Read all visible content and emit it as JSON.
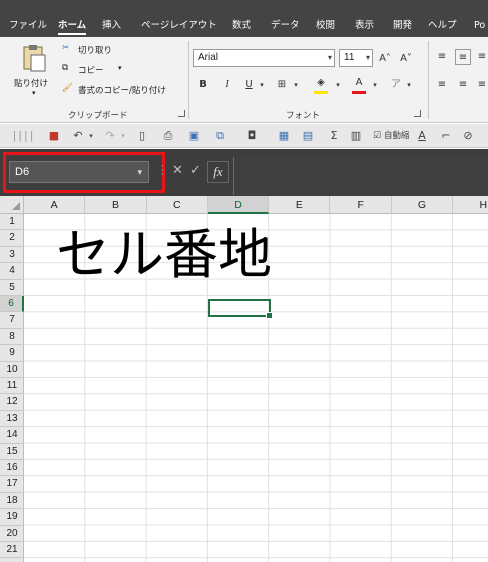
{
  "tabs": [
    {
      "label": "ファイル",
      "active": false
    },
    {
      "label": "ホーム",
      "active": true
    },
    {
      "label": "挿入",
      "active": false
    },
    {
      "label": "ページレイアウト",
      "active": false
    },
    {
      "label": "数式",
      "active": false
    },
    {
      "label": "データ",
      "active": false
    },
    {
      "label": "校閲",
      "active": false
    },
    {
      "label": "表示",
      "active": false
    },
    {
      "label": "開発",
      "active": false
    },
    {
      "label": "ヘルプ",
      "active": false
    },
    {
      "label": "Po",
      "active": false
    }
  ],
  "clipboard": {
    "paste_label": "貼り付け",
    "cut_label": "切り取り",
    "copy_label": "コピー",
    "format_painter_label": "書式のコピー/貼り付け",
    "group_label": "クリップボード"
  },
  "font": {
    "font_name": "Arial",
    "font_size": "11",
    "bold": "B",
    "italic": "I",
    "underline": "U",
    "grow": "A˄",
    "shrink": "A˅",
    "font_color_glyph": "A",
    "group_label": "フォント"
  },
  "qat": {
    "wrap_label": "自動縮"
  },
  "formula_bar": {
    "name_box": "D6",
    "fx": "fx",
    "cancel": "✕",
    "enter": "✓",
    "value": ""
  },
  "grid": {
    "columns": [
      "A",
      "B",
      "C",
      "D",
      "E",
      "F",
      "G",
      "H"
    ],
    "rows": [
      "1",
      "2",
      "3",
      "4",
      "5",
      "6",
      "7",
      "8",
      "9",
      "10",
      "11",
      "12",
      "13",
      "14",
      "15",
      "16",
      "17",
      "18",
      "19",
      "20",
      "21"
    ],
    "selected_column": "D",
    "selected_row": "6"
  },
  "overlay": {
    "caption": "セル番地"
  },
  "colors": {
    "accent_green": "#217346",
    "highlight_red": "#e8141a",
    "tab_bar_bg": "#444444"
  }
}
